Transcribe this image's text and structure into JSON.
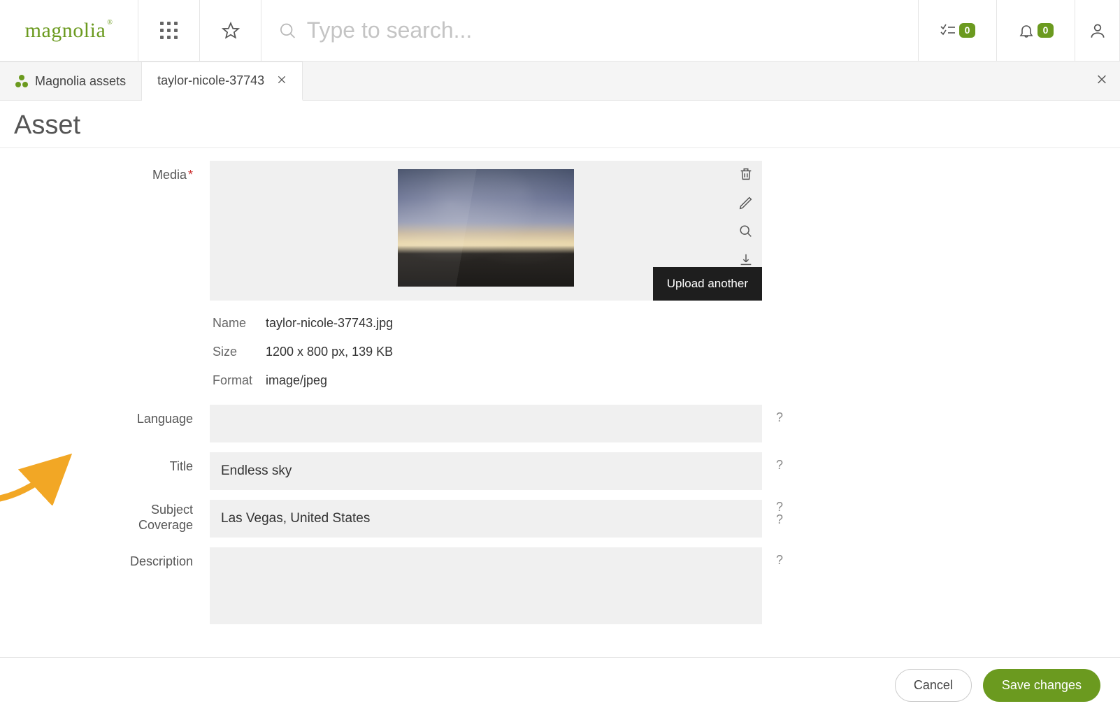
{
  "header": {
    "search_placeholder": "Type to search...",
    "tasks_badge": "0",
    "notifications_badge": "0"
  },
  "tabs": {
    "parent_label": "Magnolia assets",
    "active_label": "taylor-nicole-37743"
  },
  "page": {
    "title": "Asset"
  },
  "form": {
    "media_label": "Media",
    "upload_another_label": "Upload another",
    "meta": {
      "name_label": "Name",
      "name_value": "taylor-nicole-37743.jpg",
      "size_label": "Size",
      "size_value": "1200 x 800 px, 139 KB",
      "format_label": "Format",
      "format_value": "image/jpeg"
    },
    "language_label": "Language",
    "language_value": "",
    "title_label": "Title",
    "title_value": "Endless sky",
    "subject_label_line1": "Subject",
    "subject_label_line2": "Coverage",
    "coverage_value": "Las Vegas, United States",
    "description_label": "Description",
    "description_value": "",
    "help_marks": {
      "language": "?",
      "title": "?",
      "subject": "?",
      "coverage": "?",
      "description": "?"
    }
  },
  "footer": {
    "cancel_label": "Cancel",
    "save_label": "Save changes"
  }
}
